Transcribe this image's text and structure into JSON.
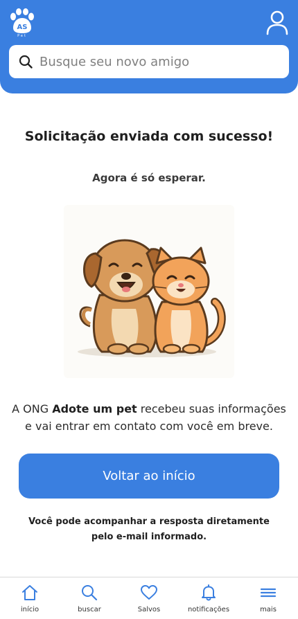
{
  "header": {
    "logo_text": "AS Pet",
    "search": {
      "placeholder": "Busque seu novo amigo"
    }
  },
  "main": {
    "title": "Solicitação enviada com sucesso!",
    "subtitle": "Agora é só esperar.",
    "message_prefix": "A ONG ",
    "ong_name": "Adote um pet",
    "message_suffix": " recebeu suas informações e vai entrar em contato com você em breve.",
    "cta_label": "Voltar ao início",
    "note": "Você pode acompanhar a resposta diretamente pelo e-mail informado."
  },
  "bottom_nav": {
    "items": [
      {
        "label": "início",
        "icon": "home-icon"
      },
      {
        "label": "buscar",
        "icon": "search-icon"
      },
      {
        "label": "Salvos",
        "icon": "heart-icon"
      },
      {
        "label": "notificações",
        "icon": "bell-icon"
      },
      {
        "label": "mais",
        "icon": "menu-icon"
      }
    ]
  },
  "colors": {
    "primary": "#3a7fe0",
    "background": "#ffffff",
    "text": "#1f1f1f"
  }
}
